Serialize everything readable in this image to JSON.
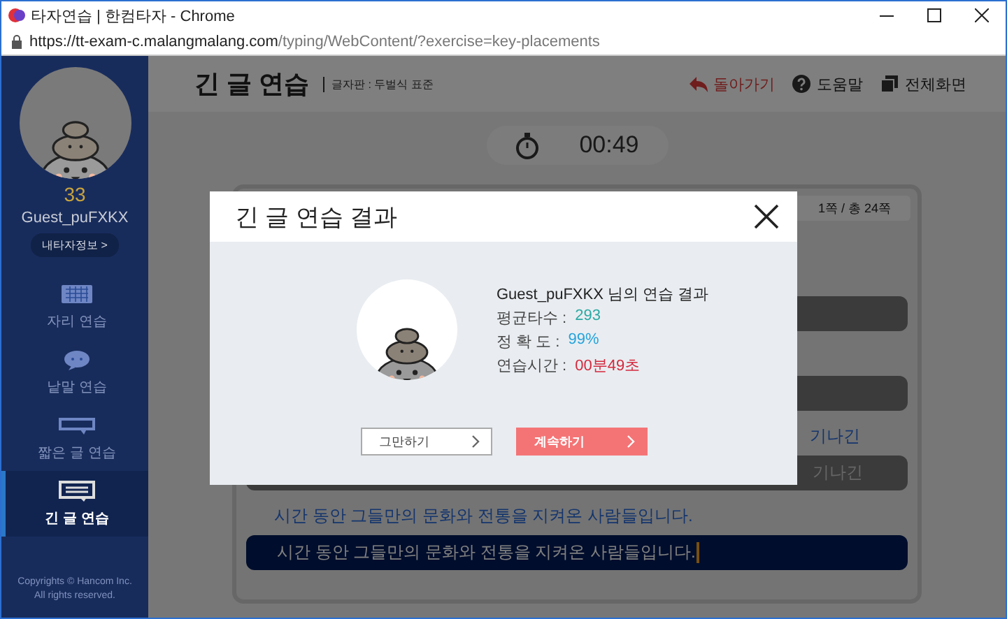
{
  "browser": {
    "title": "타자연습 | 한컴타자 - Chrome",
    "url_host": "https://tt-exam-c.malangmalang.com",
    "url_path": "/typing/WebContent/?exercise=key-placements"
  },
  "sidebar": {
    "level": "33",
    "username": "Guest_puFXKX",
    "profile_button": "내타자정보 >",
    "items": [
      {
        "label": "자리 연습",
        "kind": "keyboard",
        "selected": false
      },
      {
        "label": "낱말 연습",
        "kind": "bubble",
        "selected": false
      },
      {
        "label": "짧은 글 연습",
        "kind": "short",
        "selected": false
      },
      {
        "label": "긴 글 연습",
        "kind": "long",
        "selected": true
      }
    ],
    "copyright": [
      "Copyrights © Hancom Inc.",
      "All rights reserved."
    ]
  },
  "header": {
    "title": "긴 글 연습",
    "keyboard": "글자판 : 두벌식 표준",
    "actions": [
      {
        "label": "돌아가기",
        "kind": "back"
      },
      {
        "label": "도움말",
        "kind": "help"
      },
      {
        "label": "전체화면",
        "kind": "fullscreen"
      }
    ]
  },
  "timer": "00:49",
  "practice": {
    "page": "1쪽 / 총 24쪽",
    "lines": [
      {
        "current": false,
        "partial": false
      },
      {
        "current": false,
        "partial": false
      },
      {
        "source": "기나긴",
        "typed": "기나긴",
        "current": false,
        "partial": true
      },
      {
        "source": "시간 동안 그들만의 문화와 전통을 지켜온 사람들입니다.",
        "typed": "시간 동안 그들만의 문화와 전통을 지켜온 사람들입니다.",
        "current": true,
        "partial": false
      }
    ]
  },
  "dialog": {
    "title": "긴 글 연습 결과",
    "heading": "Guest_puFXKX 님의 연습 결과",
    "stats": [
      {
        "label": "평균타수 :",
        "value": "293",
        "color": "#2aa9a4"
      },
      {
        "label": "정 확 도 :",
        "value": "99%",
        "color": "#25a3dc"
      },
      {
        "label": "연습시간 :",
        "value": "00분49초",
        "color": "#d42a3e"
      }
    ],
    "buttons": [
      {
        "label": "그만하기",
        "kind": "secondary"
      },
      {
        "label": "계속하기",
        "kind": "primary"
      }
    ]
  }
}
